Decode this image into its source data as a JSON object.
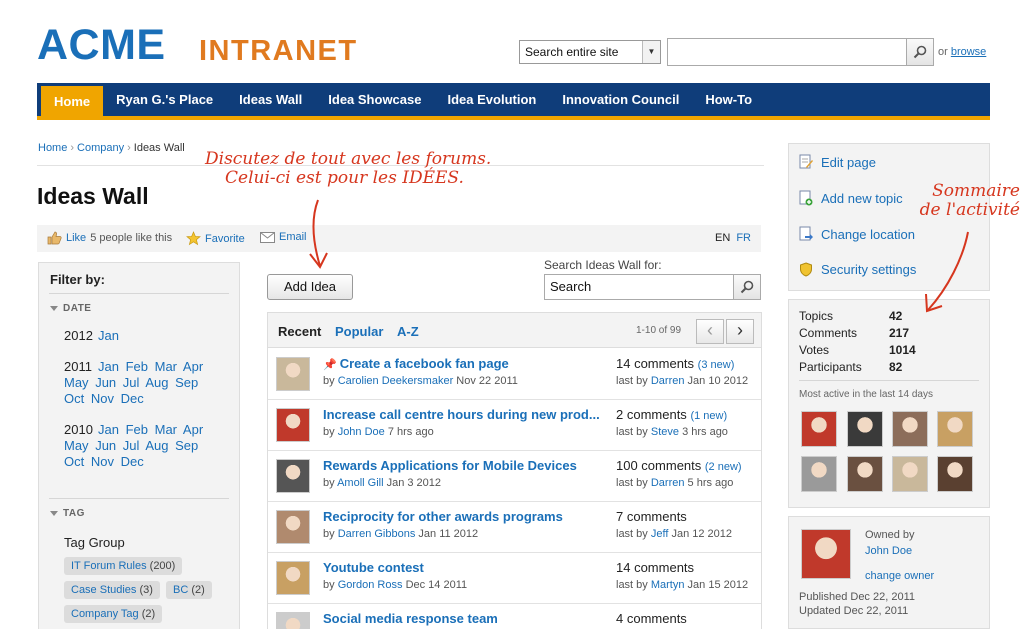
{
  "header": {
    "logo_main": "ACME",
    "logo_sub": "INTRANET",
    "search_scope": "Search entire site",
    "search_value": "",
    "or_text": "or",
    "browse": "browse"
  },
  "nav": {
    "items": [
      {
        "label": "Home",
        "active": true
      },
      {
        "label": "Ryan G.'s Place"
      },
      {
        "label": "Ideas Wall"
      },
      {
        "label": "Idea Showcase"
      },
      {
        "label": "Idea Evolution"
      },
      {
        "label": "Innovation Council"
      },
      {
        "label": "How-To"
      }
    ]
  },
  "breadcrumb": [
    "Home",
    "Company",
    "Ideas Wall"
  ],
  "page_title": "Ideas Wall",
  "action_bar": {
    "like": "Like",
    "like_count_text": "5 people like this",
    "favorite": "Favorite",
    "email": "Email",
    "lang_en": "EN",
    "lang_fr": "FR"
  },
  "filter": {
    "title": "Filter by:",
    "date_heading": "DATE",
    "years": [
      {
        "year": "2012",
        "line1": [
          "Jan"
        ],
        "line2": [],
        "line3": []
      },
      {
        "year": "2011",
        "line1": [
          "Jan",
          "Feb",
          "Mar",
          "Apr"
        ],
        "line2": [
          "May",
          "Jun",
          "Jul",
          "Aug",
          "Sep"
        ],
        "line3": [
          "Oct",
          "Nov",
          "Dec"
        ]
      },
      {
        "year": "2010",
        "line1": [
          "Jan",
          "Feb",
          "Mar",
          "Apr"
        ],
        "line2": [
          "May",
          "Jun",
          "Jul",
          "Aug",
          "Sep"
        ],
        "line3": [
          "Oct",
          "Nov",
          "Dec"
        ]
      }
    ],
    "tag_heading": "TAG",
    "tag_group_title": "Tag Group",
    "tags": [
      {
        "name": "IT Forum Rules",
        "count": "(200)"
      },
      {
        "name": "Case Studies",
        "count": "(3)"
      },
      {
        "name": "BC",
        "count": "(2)"
      },
      {
        "name": "Company Tag",
        "count": "(2)"
      }
    ]
  },
  "add_idea_label": "Add Idea",
  "ideas_search": {
    "label": "Search Ideas Wall for:",
    "value": "Search"
  },
  "list": {
    "tabs": [
      "Recent",
      "Popular",
      "A-Z"
    ],
    "paging": "1-10 of 99",
    "rows": [
      {
        "title": "Create a facebook fan page",
        "pinned": true,
        "by": "by",
        "author": "Carolien Deekersmaker",
        "date": "Nov 22 2011",
        "comments": "14 comments",
        "new": "(3 new)",
        "last_by": "last by",
        "last_author": "Darren",
        "last_date": "Jan 10 2012",
        "avatar_color": "#c9b89b"
      },
      {
        "title": "Increase call centre hours during new prod...",
        "pinned": false,
        "by": "by",
        "author": "John Doe",
        "date": "7 hrs ago",
        "comments": "2 comments",
        "new": "(1 new)",
        "last_by": "last by",
        "last_author": "Steve",
        "last_date": "3 hrs ago",
        "avatar_color": "#c0392b"
      },
      {
        "title": "Rewards Applications for Mobile Devices",
        "pinned": false,
        "by": "by",
        "author": "Amoll Gill",
        "date": "Jan 3 2012",
        "comments": "100 comments",
        "new": "(2 new)",
        "last_by": "last by",
        "last_author": "Darren",
        "last_date": "5 hrs ago",
        "avatar_color": "#555555"
      },
      {
        "title": "Reciprocity for other awards programs",
        "pinned": false,
        "by": "by",
        "author": "Darren Gibbons",
        "date": "Jan 11 2012",
        "comments": "7 comments",
        "new": "",
        "last_by": "last by",
        "last_author": "Jeff",
        "last_date": "Jan 12 2012",
        "avatar_color": "#b08a6e"
      },
      {
        "title": "Youtube contest",
        "pinned": false,
        "by": "by",
        "author": "Gordon Ross",
        "date": "Dec 14 2011",
        "comments": "14 comments",
        "new": "",
        "last_by": "last by",
        "last_author": "Martyn",
        "last_date": "Jan 15 2012",
        "avatar_color": "#c8a063"
      },
      {
        "title": "Social media response team",
        "pinned": false,
        "by": "",
        "author": "",
        "date": "",
        "comments": "4 comments",
        "new": "",
        "last_by": "",
        "last_author": "",
        "last_date": "",
        "avatar_color": "#cccccc"
      }
    ]
  },
  "right_actions": [
    {
      "label": "Edit page",
      "icon": "edit-page-icon"
    },
    {
      "label": "Add new topic",
      "icon": "add-topic-icon"
    },
    {
      "label": "Change location",
      "icon": "move-page-icon"
    },
    {
      "label": "Security settings",
      "icon": "shield-icon"
    }
  ],
  "stats": {
    "items": [
      {
        "label": "Topics",
        "value": "42"
      },
      {
        "label": "Comments",
        "value": "217"
      },
      {
        "label": "Votes",
        "value": "1014"
      },
      {
        "label": "Participants",
        "value": "82"
      }
    ],
    "most_active": "Most active in the last 14 days",
    "avatar_colors": [
      "#c0392b",
      "#3a3a3a",
      "#8c6d5a",
      "#c8a063",
      "#9a9a9a",
      "#6a5040",
      "#c9b89b",
      "#5a4030"
    ]
  },
  "owner": {
    "owned_by": "Owned by",
    "name": "John Doe",
    "change_owner": "change owner",
    "published": "Published Dec 22, 2011",
    "updated": "Updated Dec 22, 2011"
  },
  "annotations": {
    "forums_line1": "Discutez de tout avec les forums.",
    "forums_line2": "Celui-ci est pour les IDÉES.",
    "summary_line1": "Sommaire",
    "summary_line2": "de l'activité"
  },
  "colors": {
    "brand_blue": "#1a6fb8",
    "nav_blue": "#0f3d7a",
    "accent_orange": "#f0a500",
    "annotation_red": "#d6361e"
  }
}
